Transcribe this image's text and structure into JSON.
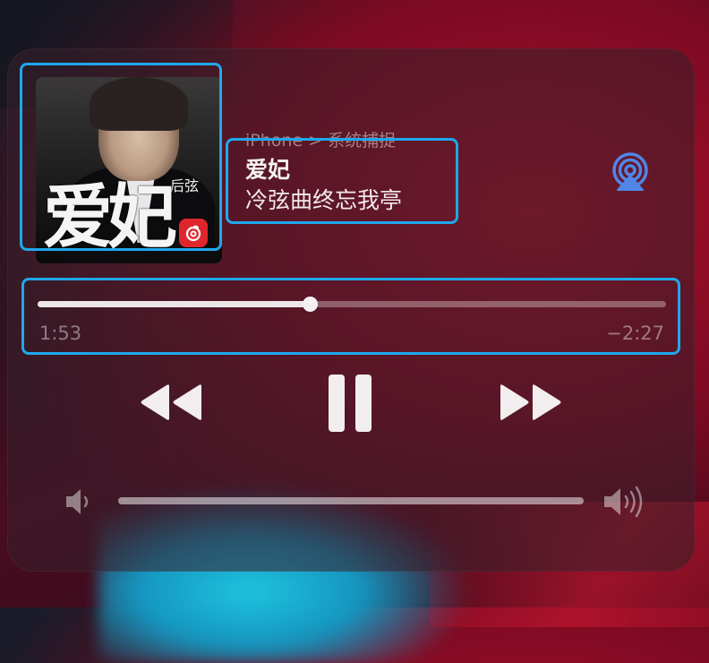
{
  "now_playing": {
    "source": "iPhone  > 系统捕捉",
    "title": "爱妃",
    "artist": "冷弦曲终忘我亭",
    "album_art": {
      "big_title": "爱妃",
      "artist_label": "后弦",
      "badge_icon": "netease-music-icon"
    }
  },
  "progress": {
    "elapsed": "1:53",
    "remaining": "−2:27",
    "fraction": 0.433
  },
  "controls": {
    "rewind_icon": "rewind-icon",
    "pause_icon": "pause-icon",
    "fast_forward_icon": "fast-forward-icon",
    "airplay_icon": "airplay-icon"
  },
  "volume": {
    "low_icon": "volume-low-icon",
    "high_icon": "volume-high-icon",
    "level": 1.0
  },
  "colors": {
    "highlight": "#1fa8ec",
    "airplay": "#4f86e8",
    "badge": "#e0262d"
  }
}
